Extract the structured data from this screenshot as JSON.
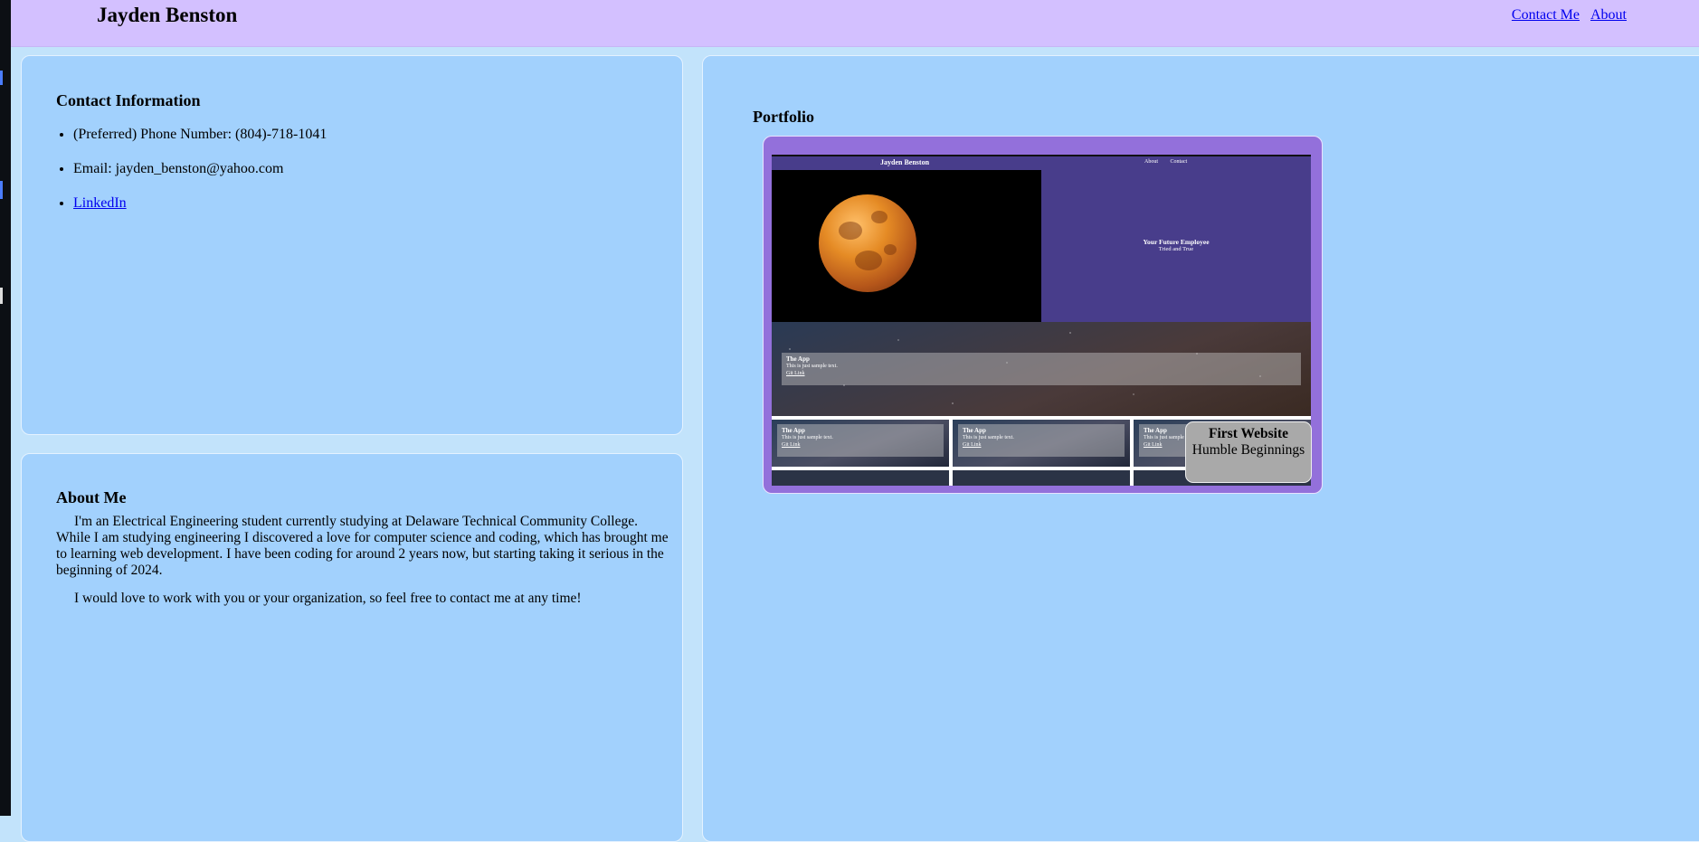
{
  "header": {
    "title": "Jayden Benston",
    "nav": [
      "Contact Me",
      "About"
    ]
  },
  "contact": {
    "heading": "Contact Information",
    "items": [
      "(Preferred) Phone Number: (804)-718-1041",
      "Email: jayden_benston@yahoo.com"
    ],
    "linkedin": "LinkedIn"
  },
  "about": {
    "heading": "About Me",
    "paragraphs": [
      "I'm an Electrical Engineering student currently studying at Delaware Technical Community College. While I am studying engineering I discovered a love for computer science and coding, which has brought me to learning web development. I have been coding for around 2 years now, but starting taking it serious in the beginning of 2024.",
      "I would love to work with you or your organization, so feel free to contact me at any time!"
    ]
  },
  "portfolio": {
    "heading": "Portfolio",
    "project": {
      "title": "First Website",
      "subtitle": "Humble Beginnings",
      "preview": {
        "site_title": "Jayden Benston",
        "nav": [
          "About",
          "Contact"
        ],
        "hero_title": "Your Future Employee",
        "hero_tagline": "Tried and True",
        "card_title": "The App",
        "card_text": "This is just sample text.",
        "card_link": "Git Link"
      }
    }
  },
  "colors": {
    "header_bg": "#d3c0ff",
    "panel_bg": "#a2d1fd",
    "page_bg": "#c2e3fb",
    "card_bg": "#9370db",
    "caption_bg": "#a9a9a9",
    "link": "#0000ee"
  }
}
